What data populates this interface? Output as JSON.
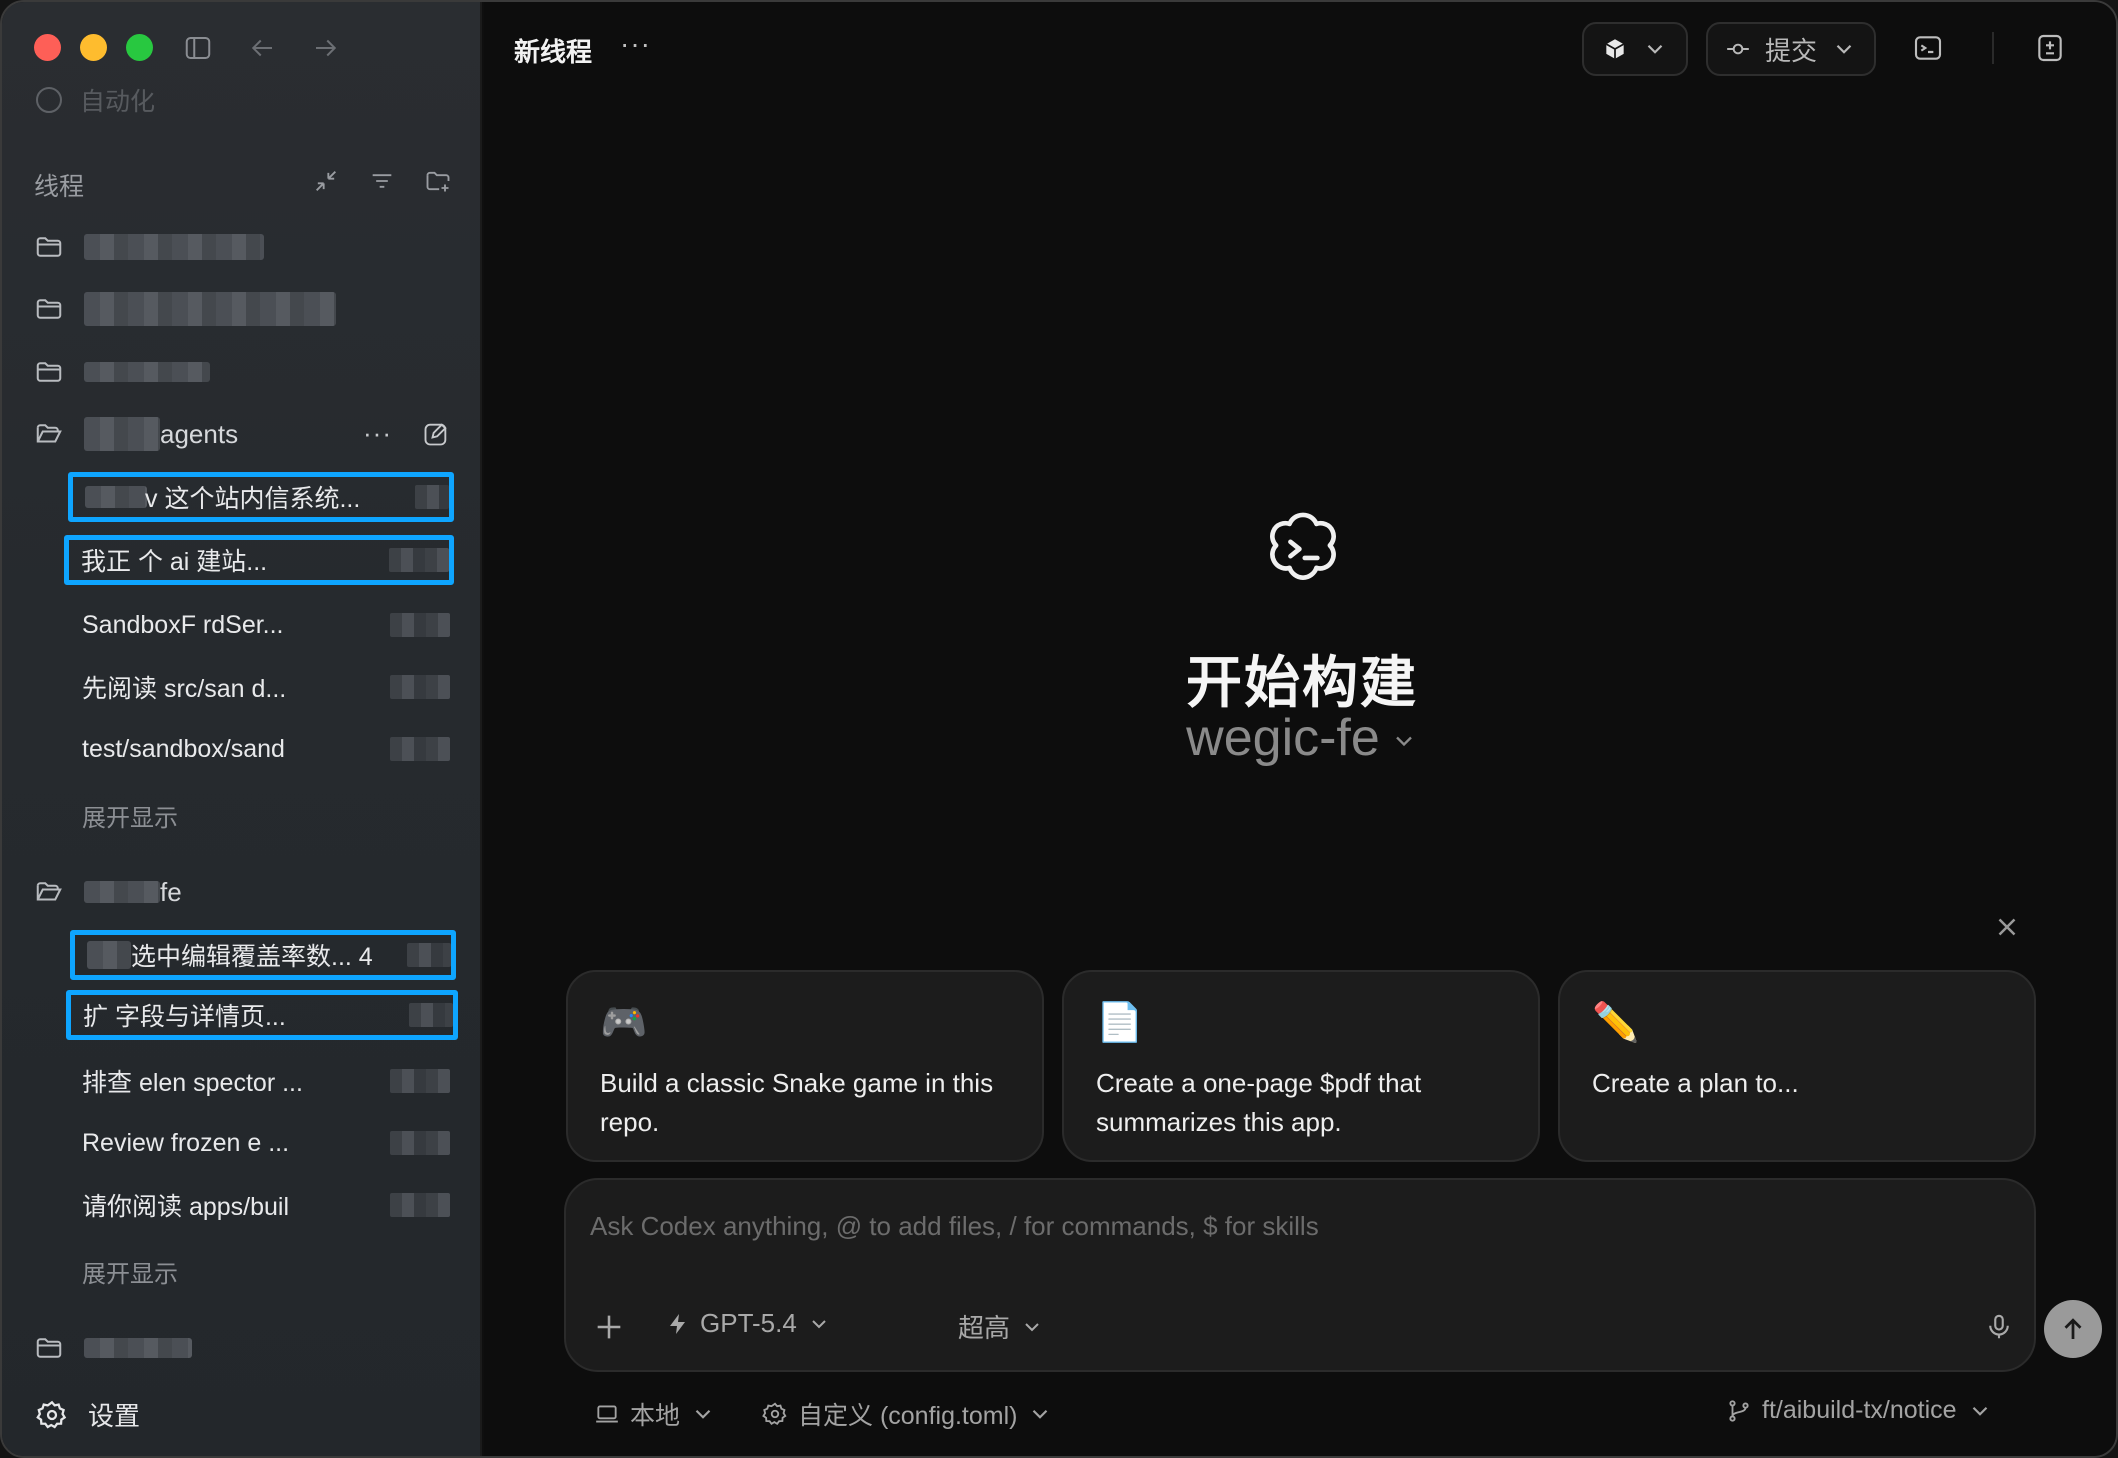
{
  "window": {
    "title": "新线程"
  },
  "sidebar": {
    "automation_label": "自动化",
    "section_title": "线程",
    "groups": [
      {
        "name": "agents"
      },
      {
        "name": "fe"
      }
    ],
    "agents_threads": [
      {
        "label": "v 这个站内信系统..."
      },
      {
        "label": "我正  个 ai 建站..."
      },
      {
        "label": "SandboxF  rdSer..."
      },
      {
        "label": "先阅读 src/san  d..."
      },
      {
        "label": "test/sandbox/sand"
      }
    ],
    "fe_threads": [
      {
        "label": "选中编辑覆盖率数...  4"
      },
      {
        "label": "扩  字段与详情页..."
      },
      {
        "label": "排查 elen  spector ..."
      },
      {
        "label": "Review frozen  e ..."
      },
      {
        "label": "请你阅读 apps/buil"
      }
    ],
    "show_more": "展开显示",
    "settings_label": "设置"
  },
  "header": {
    "title": "新线程",
    "more": "···",
    "commit_label": "提交"
  },
  "hero": {
    "title": "开始构建",
    "project": "wegic-fe"
  },
  "suggestions": [
    {
      "icon": "🎮",
      "text": "Build a classic Snake game in this repo."
    },
    {
      "icon": "📄",
      "text": "Create a one-page $pdf that summarizes this app."
    },
    {
      "icon": "✏️",
      "text": "Create a plan to..."
    }
  ],
  "composer": {
    "placeholder": "Ask Codex anything, @ to add files, / for commands, $ for skills",
    "model": "GPT-5.4",
    "effort": "超高"
  },
  "footer": {
    "env": "本地",
    "config": "自定义 (config.toml)",
    "branch": "ft/aibuild-tx/notice"
  }
}
